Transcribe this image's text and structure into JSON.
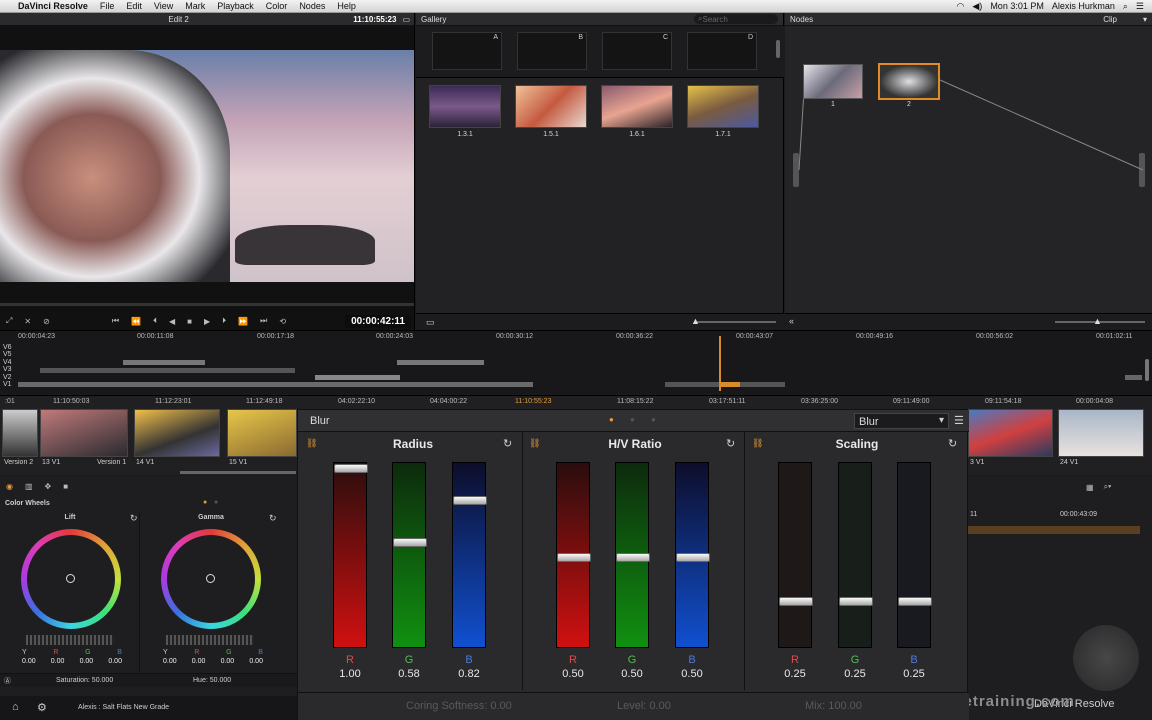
{
  "menubar": {
    "app": "DaVinci Resolve",
    "items": [
      "File",
      "Edit",
      "View",
      "Mark",
      "Playback",
      "Color",
      "Nodes",
      "Help"
    ],
    "time": "Mon 3:01 PM",
    "user": "Alexis Hurkman"
  },
  "viewer": {
    "title": "Edit 2",
    "timecode": "11:10:55:23",
    "playhead_tc": "00:00:42:11"
  },
  "gallery": {
    "title": "Gallery",
    "search_placeholder": "Search",
    "memories": [
      "A",
      "B",
      "C",
      "D"
    ],
    "stills": [
      "1.3.1",
      "1.5.1",
      "1.6.1",
      "1.7.1"
    ]
  },
  "nodes": {
    "title": "Nodes",
    "mode": "Clip",
    "node_labels": [
      "1",
      "2"
    ]
  },
  "timeline": {
    "ruler": [
      "00:00:04:23",
      "00:00:11:08",
      "00:00:17:18",
      "00:00:24:03",
      "00:00:30:12",
      "00:00:36:22",
      "00:00:43:07",
      "00:00:49:16",
      "00:00:56:02",
      "00:01:02:11"
    ],
    "tracks": [
      "V6",
      "V5",
      "V4",
      "V3",
      "V2",
      "V1"
    ]
  },
  "clips": {
    "tcs": [
      ":01",
      "11:10:50:03",
      "11:12:23:01",
      "11:12:49:18",
      "04:02:22:10",
      "04:04:00:22",
      "11:10:55:23",
      "11:08:15:22",
      "03:17:51:11",
      "03:36:25:00",
      "09:11:49:00",
      "09:11:54:18",
      "00:00:04:08"
    ],
    "names": [
      "Version 2",
      "13 V1",
      "Version 1",
      "14 V1",
      "15 V1",
      "3 V1",
      "24 V1"
    ]
  },
  "colorwheels": {
    "title": "Color Wheels",
    "wheels": [
      {
        "name": "Lift",
        "values": [
          "0.00",
          "0.00",
          "0.00",
          "0.00"
        ]
      },
      {
        "name": "Gamma",
        "values": [
          "0.00",
          "0.00",
          "0.00",
          "0.00"
        ]
      }
    ],
    "ch_letters": [
      "Y",
      "R",
      "G",
      "B"
    ],
    "saturation": "Saturation: 50.000",
    "hue": "Hue: 50.000"
  },
  "blur": {
    "title": "Blur",
    "mode": "Blur",
    "sections": [
      {
        "name": "Radius",
        "values": [
          "1.00",
          "0.58",
          "0.82"
        ]
      },
      {
        "name": "H/V Ratio",
        "values": [
          "0.50",
          "0.50",
          "0.50"
        ]
      },
      {
        "name": "Scaling",
        "values": [
          "0.25",
          "0.25",
          "0.25"
        ]
      }
    ],
    "rgb": [
      "R",
      "G",
      "B"
    ],
    "footer": [
      "Coring Softness: 0.00",
      "Level: 0.00",
      "Mix: 100.00"
    ]
  },
  "bottom": {
    "project": "Alexis : Salt Flats New Grade",
    "watermark": "rippletraining.com",
    "brand": "DaVinci Resolve"
  },
  "right_panel": {
    "tc1": "11",
    "tc2": "00:00:43:09"
  },
  "levels": {
    "radius": [
      1.0,
      0.58,
      0.82
    ],
    "hv": [
      0.5,
      0.5,
      0.5
    ],
    "scaling": [
      0.25,
      0.25,
      0.25
    ]
  }
}
